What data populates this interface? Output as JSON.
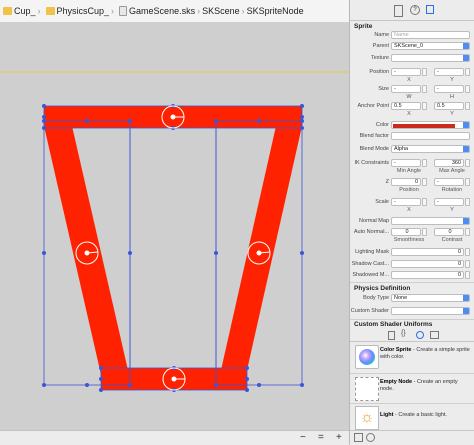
{
  "breadcrumb": [
    {
      "label": "Cup_",
      "icon": "folder-icon"
    },
    {
      "label": "PhysicsCup_",
      "icon": "folder-icon"
    },
    {
      "label": "GameScene.sks",
      "icon": "file-icon"
    },
    {
      "label": "SKScene",
      "icon": "scene-icon"
    },
    {
      "label": "SKSpriteNode",
      "icon": ""
    }
  ],
  "inspector": {
    "title": "Sprite",
    "name_label": "Name",
    "name_placeholder": "Name",
    "parent_label": "Parent",
    "parent_value": "SKScene_0",
    "texture_label": "Texture",
    "position_label": "Position",
    "position_x": "-",
    "position_y": "-",
    "size_label": "Size",
    "size_w": "-",
    "size_h": "-",
    "anchor_label": "Anchor Point",
    "anchor_x": "0.5",
    "anchor_y": "0.5",
    "x_label": "X",
    "y_label": "Y",
    "w_label": "W",
    "h_label": "H",
    "color_label": "Color",
    "color_value": "#cc2a1a",
    "blend_factor_label": "Blend factor",
    "blend_mode_label": "Blend Mode",
    "blend_mode_value": "Alpha",
    "ik_label": "IK Constraints",
    "ik_min": "-",
    "ik_max": "360",
    "min_angle_label": "Min Angle",
    "max_angle_label": "Max Angle",
    "z_label": "Z",
    "z_pos": "0",
    "z_rot": "-",
    "position_sub": "Position",
    "rotation_sub": "Rotation",
    "scale_label": "Scale",
    "scale_x": "-",
    "scale_y": "-",
    "normal_map_label": "Normal Map",
    "auto_normal_label": "Auto Normal...",
    "auto_normal_smooth": "0",
    "auto_normal_contrast": "0",
    "smoothness_label": "Smoothness",
    "contrast_label": "Contrast",
    "lighting_mask_label": "Lighting Mask",
    "lighting_mask_value": "0",
    "shadow_cast_label": "Shadow Cast...",
    "shadow_cast_value": "0",
    "shadowed_mask_label": "Shadowed M...",
    "shadowed_mask_value": "0",
    "physics_title": "Physics Definition",
    "body_type_label": "Body Type",
    "body_type_value": "None",
    "custom_shader_label": "Custom Shader",
    "uniforms_title": "Custom Shader Uniforms"
  },
  "library": [
    {
      "name": "Color Sprite",
      "desc": "Create a simple sprite with color.",
      "icon": "color-sprite-icon"
    },
    {
      "name": "Empty Node",
      "desc": "Create an empty node.",
      "icon": "empty-node-icon"
    },
    {
      "name": "Light",
      "desc": "Create a basic light.",
      "icon": "light-icon"
    }
  ],
  "colors": {
    "sprite_red": "#ff2200",
    "selection_blue": "#3b55d6",
    "accent_blue": "#4d8cf5"
  }
}
